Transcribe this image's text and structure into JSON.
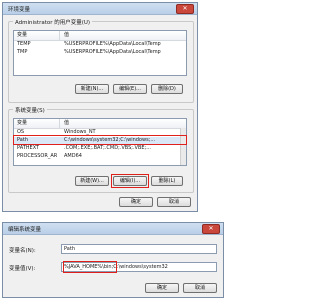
{
  "env_dialog": {
    "title": "环境变量",
    "close_glyph": "✕",
    "user_group": {
      "label": "Administrator 的用户变量(U)",
      "col_var": "变量",
      "col_val": "值",
      "rows": [
        {
          "var": "TEMP",
          "val": "%USERPROFILE%\\AppData\\Local\\Temp"
        },
        {
          "var": "TMP",
          "val": "%USERPROFILE%\\AppData\\Local\\Temp"
        }
      ],
      "new_btn": "新建(N)...",
      "edit_btn": "编辑(E)...",
      "delete_btn": "删除(D)"
    },
    "system_group": {
      "label": "系统变量(S)",
      "col_var": "变量",
      "col_val": "值",
      "rows": [
        {
          "var": "OS",
          "val": "Windows_NT"
        },
        {
          "var": "Path",
          "val": "C:\\windows\\system32;C:\\windows;..."
        },
        {
          "var": "PATHEXT",
          "val": ".COM;.EXE;.BAT;.CMD;.VBS;.VBE;..."
        },
        {
          "var": "PROCESSOR_AR",
          "val": "AMD64"
        }
      ],
      "new_btn": "新建(W)...",
      "edit_btn": "编辑(I)...",
      "delete_btn": "删除(L)"
    },
    "ok_btn": "确定",
    "cancel_btn": "取消"
  },
  "edit_dialog": {
    "title": "编辑系统变量",
    "close_glyph": "✕",
    "name_label": "变量名(N):",
    "name_value": "Path",
    "value_label": "变量值(V):",
    "value_value": "%JAVA_HOME%\\bin;C:\\windows\\system32",
    "ok_btn": "确定",
    "cancel_btn": "取消"
  }
}
